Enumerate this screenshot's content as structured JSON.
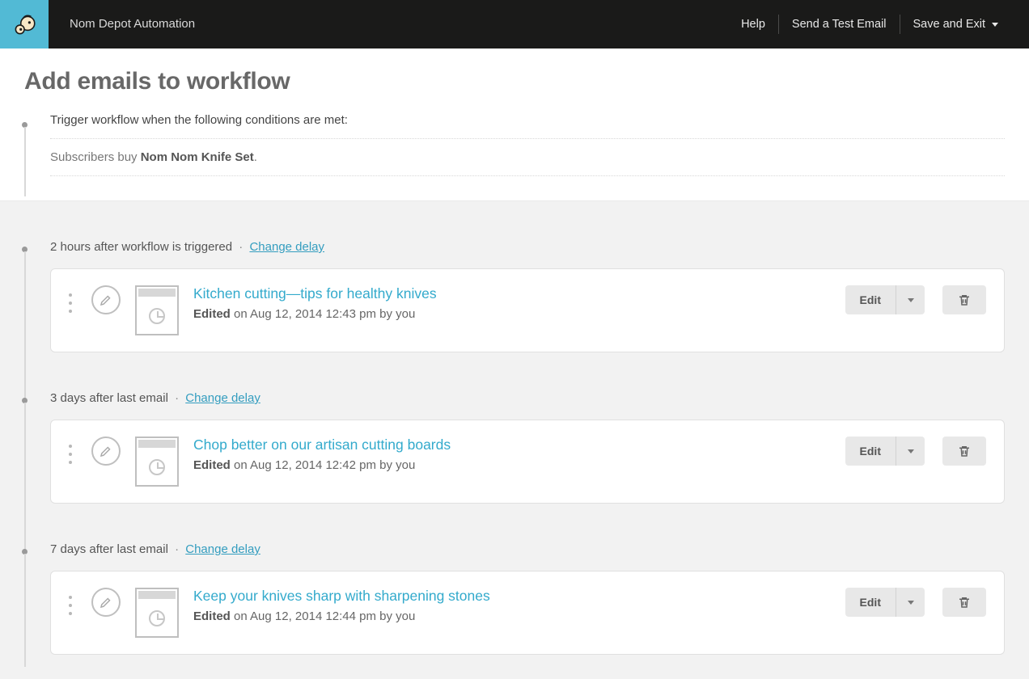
{
  "header": {
    "campaign_name": "Nom Depot Automation",
    "help": "Help",
    "send_test": "Send a Test Email",
    "save_exit": "Save and Exit"
  },
  "page": {
    "title": "Add emails to workflow",
    "trigger_heading": "Trigger workflow when the following conditions are met:",
    "trigger_prefix": "Subscribers buy ",
    "trigger_product": "Nom Nom Knife Set",
    "trigger_suffix": "."
  },
  "labels": {
    "change_delay": "Change delay",
    "edit": "Edit",
    "edited": "Edited"
  },
  "steps": [
    {
      "delay_text": "2 hours after workflow is triggered",
      "title": "Kitchen cutting—tips for healthy knives",
      "meta_rest": " on Aug 12, 2014 12:43 pm by you"
    },
    {
      "delay_text": "3 days after last email",
      "title": "Chop better on our artisan cutting boards",
      "meta_rest": " on Aug 12, 2014 12:42 pm by you"
    },
    {
      "delay_text": "7 days after last email",
      "title": "Keep your knives sharp with sharpening stones",
      "meta_rest": " on Aug 12, 2014 12:44 pm by you"
    }
  ]
}
